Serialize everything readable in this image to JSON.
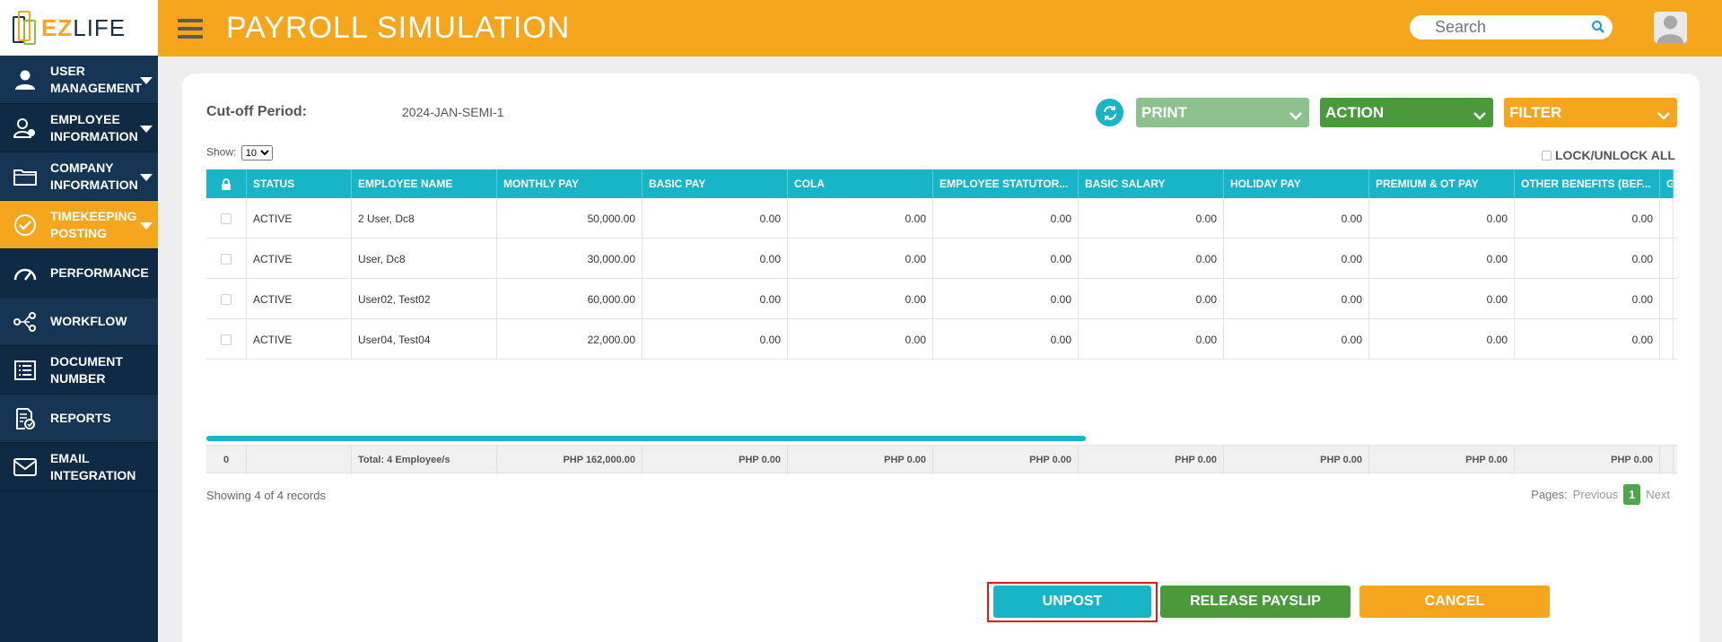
{
  "logo": {
    "ez": "EZ",
    "life": "LIFE"
  },
  "sidebar": {
    "items": [
      {
        "label": "USER MANAGEMENT",
        "icon": "user-icon",
        "caret": true
      },
      {
        "label": "EMPLOYEE INFORMATION",
        "icon": "employee-icon",
        "caret": true
      },
      {
        "label": "COMPANY INFORMATION",
        "icon": "folder-icon",
        "caret": true
      },
      {
        "label": "TIMEKEEPING POSTING",
        "icon": "check-circle-icon",
        "caret": true,
        "active": true
      },
      {
        "label": "PERFORMANCE",
        "icon": "gauge-icon"
      },
      {
        "label": "WORKFLOW",
        "icon": "workflow-icon"
      },
      {
        "label": "DOCUMENT NUMBER",
        "icon": "list-icon"
      },
      {
        "label": "REPORTS",
        "icon": "reports-icon"
      },
      {
        "label": "EMAIL INTEGRATION",
        "icon": "mail-icon"
      }
    ]
  },
  "header": {
    "title": "PAYROLL SIMULATION",
    "search_placeholder": "Search"
  },
  "colors": {
    "brand": "#f5a61d",
    "teal": "#18b4c8",
    "green": "#4a9a3c",
    "navy": "#0f2a45"
  },
  "toolbar": {
    "cutoff_label": "Cut-off Period:",
    "cutoff_value": "2024-JAN-SEMI-1",
    "print": "PRINT",
    "action": "ACTION",
    "filter": "FILTER",
    "show_label": "Show:",
    "show_value": "10",
    "lock_unlock": "LOCK/UNLOCK ALL"
  },
  "table": {
    "headers": [
      "",
      "STATUS",
      "EMPLOYEE NAME",
      "MONTHLY PAY",
      "BASIC PAY",
      "COLA",
      "EMPLOYEE STATUTOR...",
      "BASIC SALARY",
      "HOLIDAY PAY",
      "PREMIUM & OT PAY",
      "OTHER BENEFITS (BEF...",
      "G"
    ],
    "rows": [
      {
        "status": "ACTIVE",
        "name": "2 User, Dc8",
        "monthly": "50,000.00",
        "vals": [
          "0.00",
          "0.00",
          "0.00",
          "0.00",
          "0.00",
          "0.00",
          "0.00"
        ]
      },
      {
        "status": "ACTIVE",
        "name": "User, Dc8",
        "monthly": "30,000.00",
        "vals": [
          "0.00",
          "0.00",
          "0.00",
          "0.00",
          "0.00",
          "0.00",
          "0.00"
        ]
      },
      {
        "status": "ACTIVE",
        "name": "User02, Test02",
        "monthly": "60,000.00",
        "vals": [
          "0.00",
          "0.00",
          "0.00",
          "0.00",
          "0.00",
          "0.00",
          "0.00"
        ]
      },
      {
        "status": "ACTIVE",
        "name": "User04, Test04",
        "monthly": "22,000.00",
        "vals": [
          "0.00",
          "0.00",
          "0.00",
          "0.00",
          "0.00",
          "0.00",
          "0.00"
        ]
      }
    ],
    "footer": {
      "count": "0",
      "total": "Total: 4 Employee/s",
      "monthly": "PHP 162,000.00",
      "vals": [
        "PHP 0.00",
        "PHP 0.00",
        "PHP 0.00",
        "PHP 0.00",
        "PHP 0.00",
        "PHP 0.00",
        "PHP 0.00"
      ]
    }
  },
  "pagination": {
    "showing": "Showing 4 of 4 records",
    "pages_label": "Pages:",
    "previous": "Previous",
    "current": "1",
    "next": "Next"
  },
  "buttons": {
    "unpost": "UNPOST",
    "release": "RELEASE PAYSLIP",
    "cancel": "CANCEL"
  }
}
